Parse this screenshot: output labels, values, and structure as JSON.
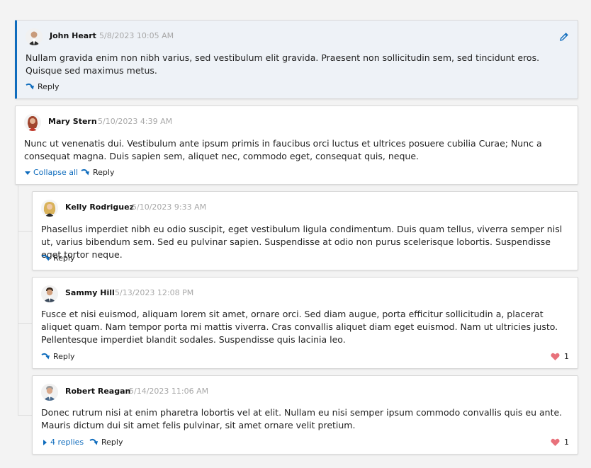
{
  "comments": [
    {
      "author": "John Heart",
      "date": "5/8/2023 10:05 AM",
      "text": "Nullam gravida enim non nibh varius, sed vestibulum elit gravida. Praesent non sollicitudin sem, sed tincidunt eros. Quisque sed maximus metus.",
      "reply_label": "Reply",
      "edit_icon": "pencil-icon"
    },
    {
      "author": "Mary Stern",
      "date": "5/10/2023 4:39 AM",
      "text": "Nunc ut venenatis dui. Vestibulum ante ipsum primis in faucibus orci luctus et ultrices posuere cubilia Curae; Nunc a consequat magna. Duis sapien sem, aliquet nec, commodo eget, consequat quis, neque.",
      "collapse_label": "Collapse all",
      "reply_label": "Reply"
    },
    {
      "author": "Kelly Rodriguez",
      "date": "5/10/2023 9:33 AM",
      "text": "Phasellus imperdiet nibh eu odio suscipit, eget vestibulum ligula condimentum. Duis quam tellus, viverra semper nisl ut, varius bibendum sem. Sed eu pulvinar sapien. Suspendisse at odio non purus scelerisque lobortis. Suspendisse eget tortor neque.",
      "reply_label": "Reply"
    },
    {
      "author": "Sammy Hill",
      "date": "5/13/2023 12:08 PM",
      "text": "Fusce et nisi euismod, aliquam lorem sit amet, ornare orci. Sed diam augue, porta efficitur sollicitudin a, placerat aliquet quam. Nam tempor porta mi mattis viverra. Cras convallis aliquet diam eget euismod. Nam ut ultricies justo. Pellentesque imperdiet blandit sodales. Suspendisse quis lacinia leo.",
      "reply_label": "Reply",
      "likes": "1"
    },
    {
      "author": "Robert Reagan",
      "date": "5/14/2023 11:06 AM",
      "text": "Donec rutrum nisi at enim pharetra lobortis vel at elit. Nullam eu nisi semper ipsum commodo convallis quis eu ante. Mauris dictum dui sit amet felis pulvinar, sit amet ornare velit pretium.",
      "replies_label": "4 replies",
      "reply_label": "Reply",
      "likes": "1"
    }
  ],
  "colors": {
    "accent": "#0f6cbd",
    "heart": "#e8717b",
    "selected_bg": "#eef2f7"
  }
}
